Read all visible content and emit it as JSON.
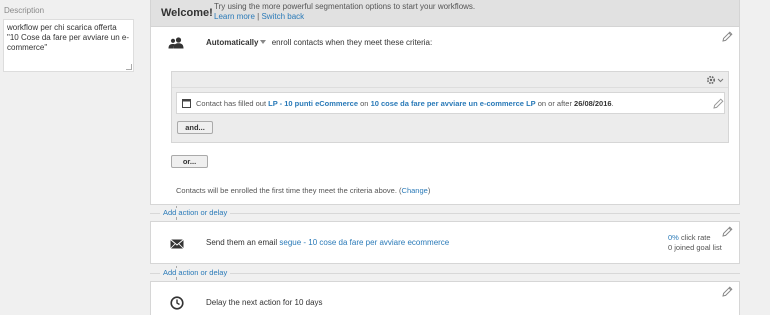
{
  "description": {
    "label": "Description",
    "value": "workflow per chi scarica offerta \"10 Cose da fare per avviare un e-commerce\""
  },
  "welcome": {
    "title": "Welcome!",
    "message": "Try using the more powerful segmentation options to start your workflows.",
    "learn_more": "Learn more",
    "separator": "|",
    "switch_back": "Switch back"
  },
  "trigger": {
    "mode": "Automatically",
    "text": "enroll contacts when they meet these criteria:"
  },
  "criteria": {
    "condition": {
      "prefix": "Contact has filled out",
      "form": "LP - 10 punti eCommerce",
      "on_word": "on",
      "page": "10 cose da fare per avviare un e-commerce LP",
      "date_prefix": "on or after",
      "date": "26/08/2016",
      "suffix": "."
    },
    "and_label": "and...",
    "or_label": "or..."
  },
  "enroll_note": {
    "text": "Contacts will be enrolled the first time they meet the criteria above.",
    "open_paren": "(",
    "change": "Change",
    "close_paren": ")"
  },
  "add_action_label": "Add action or delay",
  "email_action": {
    "text": "Send them an email",
    "email_name": "segue - 10 cose da fare per avviare ecommerce",
    "click_rate_value": "0%",
    "click_rate_label": "click rate",
    "goal_list": "0 joined goal list"
  },
  "delay_action": {
    "text": "Delay the next action for 10 days"
  }
}
